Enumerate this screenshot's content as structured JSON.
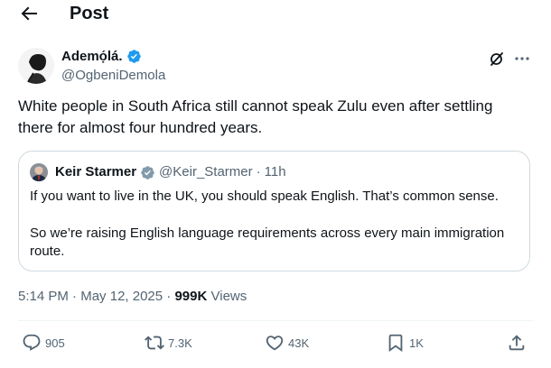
{
  "header": {
    "title": "Post",
    "back_icon": "arrow-left-icon"
  },
  "post": {
    "author": {
      "name": "Ademọ́lá.",
      "handle": "@OgbeniDemola",
      "verified": true,
      "verified_color": "#1d9bf0"
    },
    "text": "White people in South Africa still cannot speak Zulu even after settling there for almost four hundred years.",
    "quote": {
      "name": "Keir Starmer",
      "handle": "@Keir_Starmer",
      "separator": "·",
      "time": "11h",
      "verified": true,
      "verified_color": "#829aab",
      "line1": "If you want to live in the UK, you should speak English. That’s common sense.",
      "line2": "So we’re raising English language requirements across every main immigration route."
    },
    "meta": {
      "time": "5:14 PM",
      "separator": "·",
      "date": "May 12, 2025",
      "separator2": "·",
      "views_count": "999K",
      "views_label": "Views"
    },
    "actions": {
      "replies": "905",
      "reposts": "7.3K",
      "likes": "43K",
      "bookmarks": "1K"
    }
  },
  "colors": {
    "text": "#0f1419",
    "secondary": "#536471",
    "border": "#cfd9de",
    "accent": "#1d9bf0"
  }
}
